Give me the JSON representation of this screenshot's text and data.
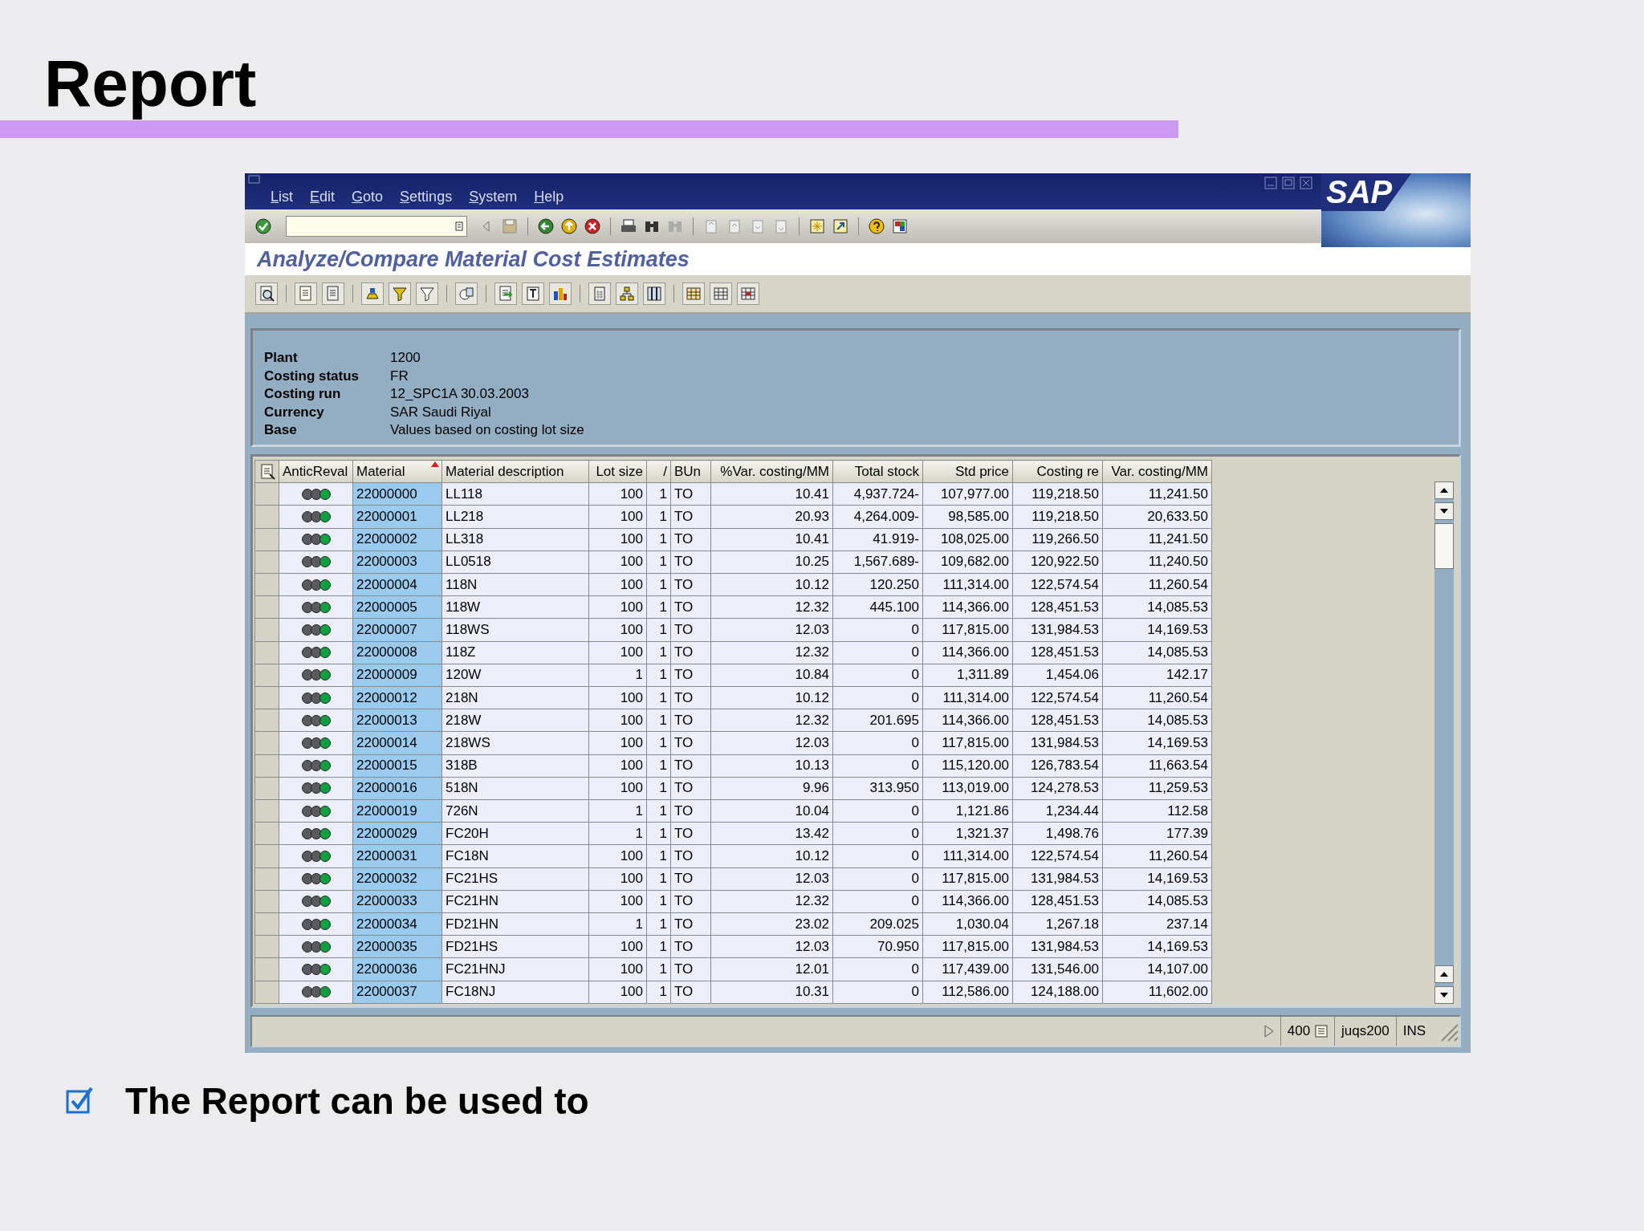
{
  "slide": {
    "title": "Report",
    "bullet": "The Report can be used to"
  },
  "window": {
    "logo": "SAP",
    "menu": [
      "List",
      "Edit",
      "Goto",
      "Settings",
      "System",
      "Help"
    ],
    "title": "Analyze/Compare Material Cost Estimates"
  },
  "header_info": [
    {
      "label": "Plant",
      "value": "1200"
    },
    {
      "label": "Costing status",
      "value": "FR"
    },
    {
      "label": "Costing run",
      "value": "12_SPC1A 30.03.2003"
    },
    {
      "label": "Currency",
      "value": "SAR Saudi Riyal"
    },
    {
      "label": "Base",
      "value": "Values based on costing lot size"
    }
  ],
  "table": {
    "columns": [
      {
        "label": "AnticReval",
        "kind": "light"
      },
      {
        "label": "Material",
        "kind": "key",
        "sorted": true
      },
      {
        "label": "Material description",
        "kind": "text"
      },
      {
        "label": "Lot size",
        "kind": "number"
      },
      {
        "label": "/",
        "kind": "number"
      },
      {
        "label": "BUn",
        "kind": "text"
      },
      {
        "label": "%Var. costing/MM",
        "kind": "number"
      },
      {
        "label": "Total stock",
        "kind": "number"
      },
      {
        "label": "Std price",
        "kind": "number"
      },
      {
        "label": "Costing re",
        "kind": "number"
      },
      {
        "label": "Var. costing/MM",
        "kind": "number"
      }
    ],
    "rows": [
      {
        "green": true,
        "cells": [
          "",
          "22000000",
          "LL118",
          "100",
          "1",
          "TO",
          "10.41",
          "4,937.724-",
          "107,977.00",
          "119,218.50",
          "11,241.50"
        ]
      },
      {
        "green": true,
        "cells": [
          "",
          "22000001",
          "LL218",
          "100",
          "1",
          "TO",
          "20.93",
          "4,264.009-",
          "98,585.00",
          "119,218.50",
          "20,633.50"
        ]
      },
      {
        "green": true,
        "cells": [
          "",
          "22000002",
          "LL318",
          "100",
          "1",
          "TO",
          "10.41",
          "41.919-",
          "108,025.00",
          "119,266.50",
          "11,241.50"
        ]
      },
      {
        "green": true,
        "cells": [
          "",
          "22000003",
          "LL0518",
          "100",
          "1",
          "TO",
          "10.25",
          "1,567.689-",
          "109,682.00",
          "120,922.50",
          "11,240.50"
        ]
      },
      {
        "green": true,
        "cells": [
          "",
          "22000004",
          "118N",
          "100",
          "1",
          "TO",
          "10.12",
          "120.250",
          "111,314.00",
          "122,574.54",
          "11,260.54"
        ]
      },
      {
        "green": true,
        "cells": [
          "",
          "22000005",
          "118W",
          "100",
          "1",
          "TO",
          "12.32",
          "445.100",
          "114,366.00",
          "128,451.53",
          "14,085.53"
        ]
      },
      {
        "green": true,
        "cells": [
          "",
          "22000007",
          "118WS",
          "100",
          "1",
          "TO",
          "12.03",
          "0",
          "117,815.00",
          "131,984.53",
          "14,169.53"
        ]
      },
      {
        "green": true,
        "cells": [
          "",
          "22000008",
          "118Z",
          "100",
          "1",
          "TO",
          "12.32",
          "0",
          "114,366.00",
          "128,451.53",
          "14,085.53"
        ]
      },
      {
        "green": true,
        "cells": [
          "",
          "22000009",
          "120W",
          "1",
          "1",
          "TO",
          "10.84",
          "0",
          "1,311.89",
          "1,454.06",
          "142.17"
        ]
      },
      {
        "green": true,
        "cells": [
          "",
          "22000012",
          "218N",
          "100",
          "1",
          "TO",
          "10.12",
          "0",
          "111,314.00",
          "122,574.54",
          "11,260.54"
        ]
      },
      {
        "green": true,
        "cells": [
          "",
          "22000013",
          "218W",
          "100",
          "1",
          "TO",
          "12.32",
          "201.695",
          "114,366.00",
          "128,451.53",
          "14,085.53"
        ]
      },
      {
        "green": true,
        "cells": [
          "",
          "22000014",
          "218WS",
          "100",
          "1",
          "TO",
          "12.03",
          "0",
          "117,815.00",
          "131,984.53",
          "14,169.53"
        ]
      },
      {
        "green": true,
        "cells": [
          "",
          "22000015",
          "318B",
          "100",
          "1",
          "TO",
          "10.13",
          "0",
          "115,120.00",
          "126,783.54",
          "11,663.54"
        ]
      },
      {
        "green": true,
        "cells": [
          "",
          "22000016",
          "518N",
          "100",
          "1",
          "TO",
          "9.96",
          "313.950",
          "113,019.00",
          "124,278.53",
          "11,259.53"
        ]
      },
      {
        "green": true,
        "cells": [
          "",
          "22000019",
          "726N",
          "1",
          "1",
          "TO",
          "10.04",
          "0",
          "1,121.86",
          "1,234.44",
          "112.58"
        ]
      },
      {
        "green": true,
        "cells": [
          "",
          "22000029",
          "FC20H",
          "1",
          "1",
          "TO",
          "13.42",
          "0",
          "1,321.37",
          "1,498.76",
          "177.39"
        ]
      },
      {
        "green": true,
        "cells": [
          "",
          "22000031",
          "FC18N",
          "100",
          "1",
          "TO",
          "10.12",
          "0",
          "111,314.00",
          "122,574.54",
          "11,260.54"
        ]
      },
      {
        "green": true,
        "cells": [
          "",
          "22000032",
          "FC21HS",
          "100",
          "1",
          "TO",
          "12.03",
          "0",
          "117,815.00",
          "131,984.53",
          "14,169.53"
        ]
      },
      {
        "green": true,
        "cells": [
          "",
          "22000033",
          "FC21HN",
          "100",
          "1",
          "TO",
          "12.32",
          "0",
          "114,366.00",
          "128,451.53",
          "14,085.53"
        ]
      },
      {
        "green": true,
        "cells": [
          "",
          "22000034",
          "FD21HN",
          "1",
          "1",
          "TO",
          "23.02",
          "209.025",
          "1,030.04",
          "1,267.18",
          "237.14"
        ]
      },
      {
        "green": true,
        "cells": [
          "",
          "22000035",
          "FD21HS",
          "100",
          "1",
          "TO",
          "12.03",
          "70.950",
          "117,815.00",
          "131,984.53",
          "14,169.53"
        ]
      },
      {
        "green": true,
        "cells": [
          "",
          "22000036",
          "FC21HNJ",
          "100",
          "1",
          "TO",
          "12.01",
          "0",
          "117,439.00",
          "131,546.00",
          "14,107.00"
        ]
      },
      {
        "green": true,
        "cells": [
          "",
          "22000037",
          "FC18NJ",
          "100",
          "1",
          "TO",
          "10.31",
          "0",
          "112,586.00",
          "124,188.00",
          "11,602.00"
        ]
      }
    ]
  },
  "status_bar": {
    "client": "400",
    "server": "juqs200",
    "mode": "INS"
  }
}
